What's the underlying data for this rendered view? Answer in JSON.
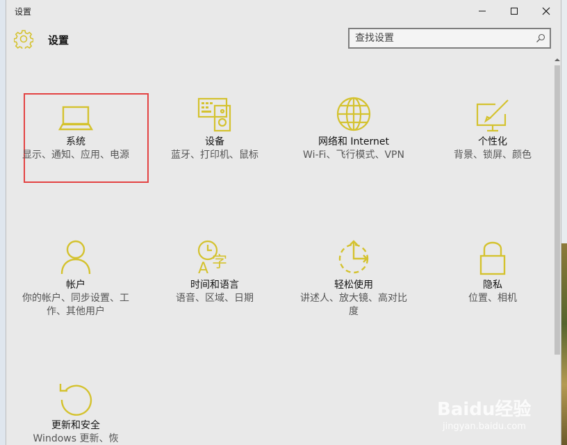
{
  "window": {
    "title": "设置"
  },
  "header": {
    "title": "设置",
    "search_placeholder": "查找设置"
  },
  "tiles": [
    {
      "name": "系统",
      "desc": "显示、通知、应用、电源",
      "icon": "laptop-icon"
    },
    {
      "name": "设备",
      "desc": "蓝牙、打印机、鼠标",
      "icon": "keyboard-speaker-icon"
    },
    {
      "name": "网络和 Internet",
      "desc": "Wi-Fi、飞行模式、VPN",
      "icon": "globe-icon"
    },
    {
      "name": "个性化",
      "desc": "背景、锁屏、颜色",
      "icon": "paint-brush-icon"
    },
    {
      "name": "帐户",
      "desc": "你的帐户、同步设置、工作、其他用户",
      "icon": "person-icon"
    },
    {
      "name": "时间和语言",
      "desc": "语音、区域、日期",
      "icon": "clock-language-icon"
    },
    {
      "name": "轻松使用",
      "desc": "讲述人、放大镜、高对比度",
      "icon": "ease-of-access-icon"
    },
    {
      "name": "隐私",
      "desc": "位置、相机",
      "icon": "lock-icon"
    },
    {
      "name": "更新和安全",
      "desc": "Windows 更新、恢",
      "icon": "refresh-icon"
    }
  ],
  "colors": {
    "accent": "#d4c22e",
    "window_bg": "#e9e9e9",
    "highlight": "#e34242"
  },
  "watermark": {
    "brand": "Baidu经验",
    "url": "jingyan.baidu.com"
  }
}
